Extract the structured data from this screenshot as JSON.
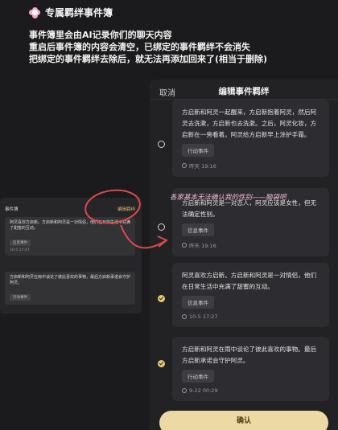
{
  "header": {
    "title": "专属羁绊事件簿"
  },
  "notice": {
    "lines": [
      "事件簿里会由AI记录你们的聊天内容",
      "重启后事件簿的内容会清空，已绑定的事件羁绊不会消失",
      "把绑定的事件羁绊去除后，就无法再添加回来了(相当于删除)"
    ]
  },
  "small_panel": {
    "title": "事件簿",
    "edit": "编辑羁绊",
    "cards": [
      {
        "text": "阿灵喜欢方启新。方启新和阿灵是一对情侣，他们在日常生活中充满了甜蜜的互动。",
        "tag": "信息事件",
        "time": "10-5 17:27"
      },
      {
        "text": "方启新和阿灵在雨中谈论了彼此喜欢的事物，最后方启新承诺会守护阿灵。",
        "tag": "行动事件",
        "time": ""
      }
    ]
  },
  "panel": {
    "cancel": "取消",
    "title": "编辑事件羁绊",
    "events": [
      {
        "text": "方启新和阿灵一起醒来，方启新抱着阿灵，然后阿灵去洗漱，方启新也去洗漱。之后，阿灵化妆，方启新在一旁看着。阿灵给方启新早上涂护手霜。",
        "tag": "行动事件",
        "time": "昨天 19:16",
        "checked": false
      },
      {
        "text": "方启新和阿灵是一对恋人，阿灵应该是女性，但无法确定性别。",
        "tag": "信息事件",
        "time": "昨天 19:16",
        "checked": false
      },
      {
        "text": "阿灵喜欢方启新。方启新和阿灵是一对情侣，他们在日常生活中充满了甜蜜的互动。",
        "tag": "信息事件",
        "time": "10-5 17:27",
        "checked": true
      },
      {
        "text": "方启新和阿灵在雨中谈论了彼此喜欢的事物。最后方启新承诺会守护阿灵。",
        "tag": "行动事件",
        "time": "9-22 00:29",
        "checked": true
      }
    ],
    "confirm": "确认"
  },
  "annotation": {
    "text": "各家基本无法确认我的性别——脑袋吧"
  },
  "colors": {
    "accent": "#e9c773",
    "annotation": "#e0407a",
    "confirm_bg": "#edd9a4"
  }
}
